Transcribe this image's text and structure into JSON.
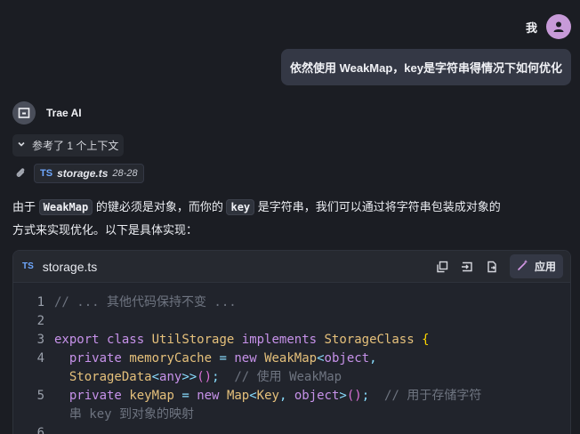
{
  "user": {
    "name": "我",
    "message": "依然使用 WeakMap，key是字符串得情况下如何优化"
  },
  "assistant": {
    "name": "Trae AI",
    "references_label": "参考了 1 个上下文",
    "file_ref": {
      "name": "storage.ts",
      "range": "28-28",
      "lang_badge": "TS"
    },
    "para": {
      "p1": "由于",
      "code1": "WeakMap",
      "p2": "的键必须是对象，而你的",
      "code2": "key",
      "p3": "是字符串，我们可以通过将字符串包装成对象的",
      "line2": "方式来实现优化。以下是具体实现："
    }
  },
  "code_block": {
    "lang_badge": "TS",
    "filename": "storage.ts",
    "apply_label": "应用",
    "line_numbers": [
      "1",
      "2",
      "3",
      "4",
      "5",
      "6"
    ],
    "lines": [
      "// ... 其他代码保持不变 ...",
      "",
      "export class UtilStorage implements StorageClass {",
      "  private memoryCache = new WeakMap<object,",
      "  StorageData<any>>();  // 使用 WeakMap",
      "  private keyMap = new Map<Key, object>();  // 用于存储字符",
      "  串 key 到对象的映射"
    ]
  },
  "colors": {
    "background": "#1b1d23",
    "bubble": "#343845",
    "accent_ts": "#6fa8ff",
    "keyword": "#c792ea",
    "class_name": "#e5c07b"
  },
  "icons": [
    "user-avatar-icon",
    "trae-logo-icon",
    "chevron-down-icon",
    "paperclip-icon",
    "copy-icon",
    "insert-icon",
    "new-file-icon",
    "apply-wand-icon"
  ]
}
